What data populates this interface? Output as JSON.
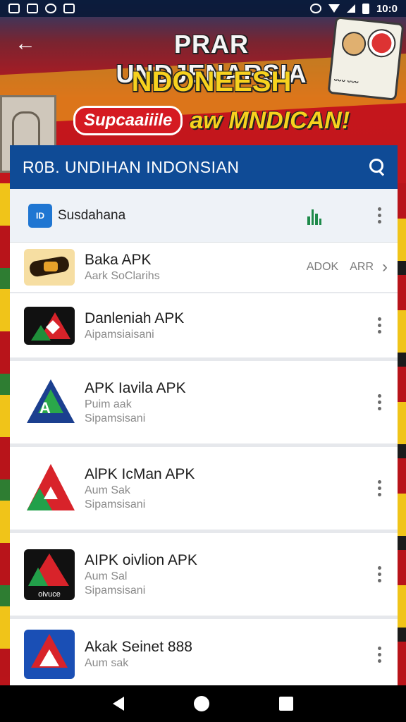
{
  "status_bar": {
    "time": "10:0"
  },
  "banner": {
    "title": "PRAR UNDJENARSIA",
    "subtitle": "NDONEESH",
    "promo_pill": "Supcaaiiile",
    "promo_text": "aw MNDICAN!"
  },
  "toolbar": {
    "title": "R0B. UNDIHAN INDONSIAN"
  },
  "section": {
    "label": "Susdahana"
  },
  "apps": [
    {
      "name": "Baka APK",
      "sub1": "Aark SoClarihs",
      "sub2": "",
      "tag1": "ADOK",
      "tag2": "ARR"
    },
    {
      "name": "Danleniah APK",
      "sub1": "Aipamsiaisani",
      "sub2": ""
    },
    {
      "name": "APK Iavila APK",
      "sub1": "Puim aak",
      "sub2": "Sipamsisani"
    },
    {
      "name": "AlPK IcMan APK",
      "sub1": "Aum Sak",
      "sub2": "Sipamsisani"
    },
    {
      "name": "AIPK oivlion APK",
      "sub1": "Aum Sal",
      "sub2": "Sipamsisani",
      "badge": "oivuce"
    },
    {
      "name": "Akak Seinet 888",
      "sub1": "Aum sak",
      "sub2": ""
    }
  ],
  "colors": {
    "toolbar": "#0f4b96",
    "accent_red": "#d51a22",
    "accent_yellow": "#f7d21e"
  }
}
